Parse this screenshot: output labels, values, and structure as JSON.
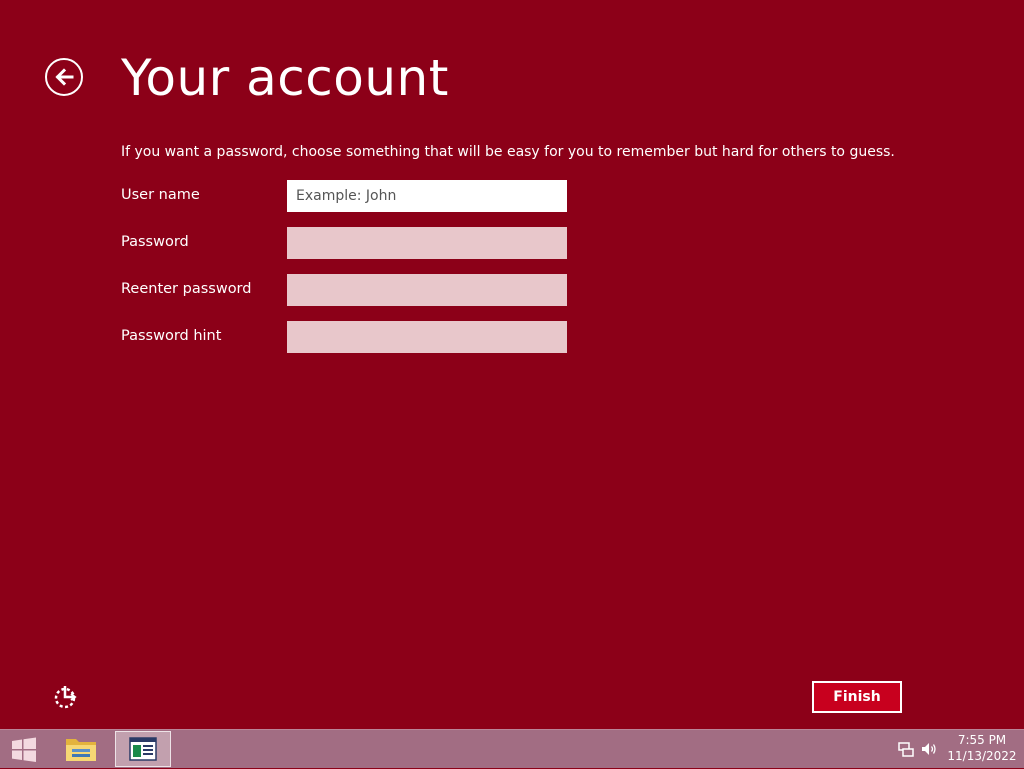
{
  "setup": {
    "title": "Your account",
    "instructions": "If you want a password, choose something that will be easy for you to remember but hard for others to guess.",
    "fields": {
      "username": {
        "label": "User name",
        "placeholder": "Example: John",
        "value": ""
      },
      "password": {
        "label": "Password",
        "value": ""
      },
      "reenter_password": {
        "label": "Reenter password",
        "value": ""
      },
      "password_hint": {
        "label": "Password hint",
        "value": ""
      }
    },
    "finish_label": "Finish",
    "back_icon": "back-arrow-icon",
    "ease_of_access_icon": "ease-of-access-icon"
  },
  "taskbar": {
    "start_icon": "windows-logo-icon",
    "items": [
      {
        "name": "File Explorer",
        "icon": "folder-icon",
        "active": false
      },
      {
        "name": "Setup",
        "icon": "setup-window-icon",
        "active": true
      }
    ],
    "tray_icons": [
      "network-icon",
      "volume-icon"
    ],
    "time": "7:55 PM",
    "date": "11/13/2022"
  },
  "colors": {
    "background": "#8c0018",
    "taskbar": "#a26d83",
    "inactive_field": "#e8c7cb",
    "finish_button": "#c8001e"
  }
}
